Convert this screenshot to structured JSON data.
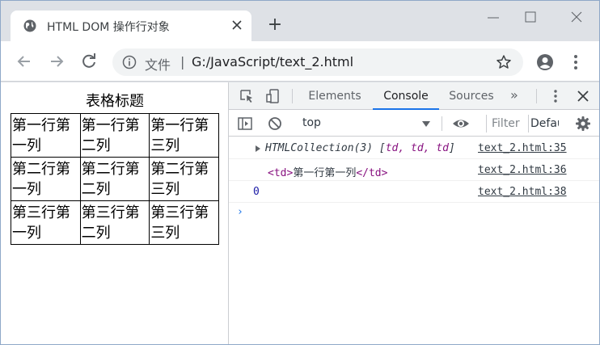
{
  "browser": {
    "tab": {
      "title": "HTML DOM 操作行对象",
      "icon": "globe-icon"
    },
    "new_tab": "+",
    "omnibox": {
      "security_label": "文件",
      "separator": "|",
      "url": "G:/JavaScript/text_2.html"
    }
  },
  "page": {
    "caption": "表格标题",
    "rows": [
      [
        "第一行第一列",
        "第一行第二列",
        "第一行第三列"
      ],
      [
        "第二行第一列",
        "第二行第二列",
        "第二行第三列"
      ],
      [
        "第三行第一列",
        "第三行第二列",
        "第三行第三列"
      ]
    ]
  },
  "devtools": {
    "tabs": {
      "elements": "Elements",
      "console": "Console",
      "sources": "Sources",
      "more": "»"
    },
    "active_tab": "Console",
    "context": "top",
    "filter_placeholder": "Filter",
    "levels": "Default levels",
    "messages": [
      {
        "prefix": "HTMLCollection(3) ",
        "open": "[",
        "items": "td, td, td",
        "close": "]",
        "source": "text_2.html:35"
      },
      {
        "open_tag": "<td>",
        "text": "第一行第一列",
        "close_tag": "</td>",
        "source": "text_2.html:36"
      },
      {
        "value": "0",
        "source": "text_2.html:38"
      }
    ],
    "prompt": "›"
  },
  "colors": {
    "accent": "#1a73e8",
    "tag": "#881280",
    "number": "#1a1aa6"
  }
}
